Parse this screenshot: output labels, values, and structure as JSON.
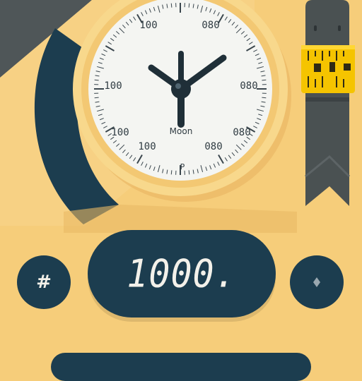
{
  "dial": {
    "labels": [
      "100",
      "080",
      "100",
      "080",
      "100",
      "080",
      "100",
      "080"
    ],
    "center_label": "Moon",
    "bottom_label": "P"
  },
  "display": {
    "reading": "1000."
  },
  "left_button": {
    "label": "#"
  },
  "right_button": {
    "icon": "diamond-icon"
  },
  "colors": {
    "background": "#f6cd7a",
    "dial_ring": "#f8d88c",
    "dial_face": "#f4f5f2",
    "dark_navy": "#1c3d4f",
    "tape_yellow": "#f5c400",
    "dark_gray": "#4a5152"
  }
}
